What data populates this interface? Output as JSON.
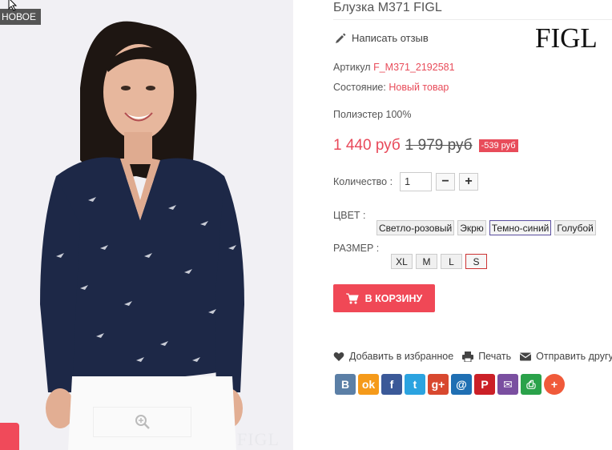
{
  "image": {
    "badge": "НОВОЕ",
    "watermark": "FIGL"
  },
  "product": {
    "title": "Блузка M371 FIGL",
    "review_link": "Написать отзыв",
    "brand": "FIGL",
    "sku_label": "Артикул",
    "sku_value": "F_M371_2192581",
    "condition_label": "Состояние:",
    "condition_value": "Новый товар",
    "material": "Полиэстер 100%",
    "price": "1 440 руб",
    "old_price": "1 979 руб",
    "discount": "-539 руб"
  },
  "quantity": {
    "label": "Количество :",
    "value": "1",
    "minus": "−",
    "plus": "+"
  },
  "color": {
    "label": "ЦВЕТ :",
    "options": [
      "Светло-розовый",
      "Экрю",
      "Темно-синий",
      "Голубой"
    ],
    "selected": "Темно-синий"
  },
  "size": {
    "label": "РАЗМЕР :",
    "options": [
      "XL",
      "M",
      "L",
      "S"
    ],
    "selected": "S"
  },
  "cart_button": "В КОРЗИНУ",
  "links": {
    "favorite": "Добавить в избранное",
    "print": "Печать",
    "send": "Отправить другу"
  },
  "share_icons": [
    {
      "name": "vk-icon",
      "label": "В",
      "color": "#5b7fa6"
    },
    {
      "name": "odnoklassniki-icon",
      "label": "ok",
      "color": "#f59a1a"
    },
    {
      "name": "facebook-icon",
      "label": "f",
      "color": "#3b5998"
    },
    {
      "name": "twitter-icon",
      "label": "t",
      "color": "#2ba3e0"
    },
    {
      "name": "googleplus-icon",
      "label": "g+",
      "color": "#d8482f"
    },
    {
      "name": "mailru-icon",
      "label": "@",
      "color": "#1f6fb3"
    },
    {
      "name": "pinterest-icon",
      "label": "P",
      "color": "#cb2027"
    },
    {
      "name": "email-icon",
      "label": "✉",
      "color": "#7a4fa0"
    },
    {
      "name": "print-icon",
      "label": "⎙",
      "color": "#2aa24a"
    },
    {
      "name": "more-icon",
      "label": "+",
      "color": "#f05a3a"
    }
  ]
}
